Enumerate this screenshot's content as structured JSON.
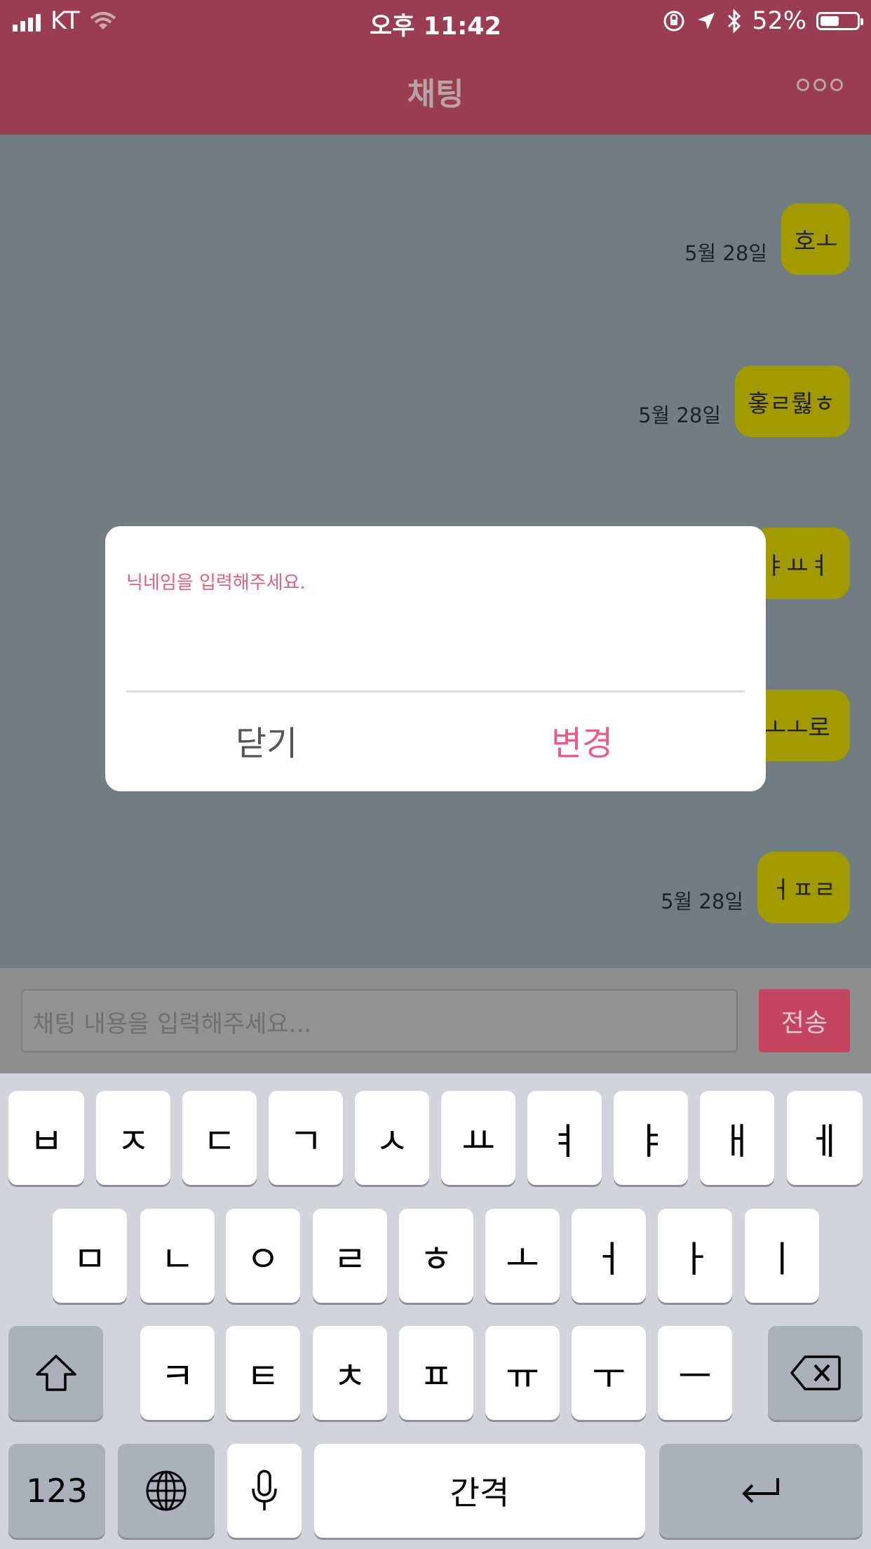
{
  "status_bar": {
    "carrier": "KT",
    "time": "오후 11:42",
    "battery": "52%",
    "battery_level": 0.52
  },
  "header": {
    "title": "채팅",
    "more_icon": "ellipsis-icon"
  },
  "messages": [
    {
      "text": "호ㅗ",
      "date": "5월 28일"
    },
    {
      "text": "홓ㄹ뤓ㅎ",
      "date": "5월 28일"
    },
    {
      "text": "ㅑㅛㅕ",
      "date": ""
    },
    {
      "text": "ㅗㅗ로",
      "date": ""
    },
    {
      "text": "ㅓㅍㄹ",
      "date": "5월 28일"
    }
  ],
  "composer": {
    "placeholder": "채팅 내용을 입력해주세요...",
    "send_label": "전송"
  },
  "dialog": {
    "label": "닉네임을 입력해주세요.",
    "close_label": "닫기",
    "change_label": "변경"
  },
  "keyboard": {
    "row1": [
      "ㅂ",
      "ㅈ",
      "ㄷ",
      "ㄱ",
      "ㅅ",
      "ㅛ",
      "ㅕ",
      "ㅑ",
      "ㅐ",
      "ㅔ"
    ],
    "row2": [
      "ㅁ",
      "ㄴ",
      "ㅇ",
      "ㄹ",
      "ㅎ",
      "ㅗ",
      "ㅓ",
      "ㅏ",
      "ㅣ"
    ],
    "row3": [
      "ㅋ",
      "ㅌ",
      "ㅊ",
      "ㅍ",
      "ㅠ",
      "ㅜ",
      "ㅡ"
    ],
    "numbers_label": "123",
    "space_label": "간격"
  },
  "colors": {
    "header": "#9a3d50",
    "bubble": "#a19b00",
    "accent": "#ea5b86",
    "send": "#c44560"
  }
}
